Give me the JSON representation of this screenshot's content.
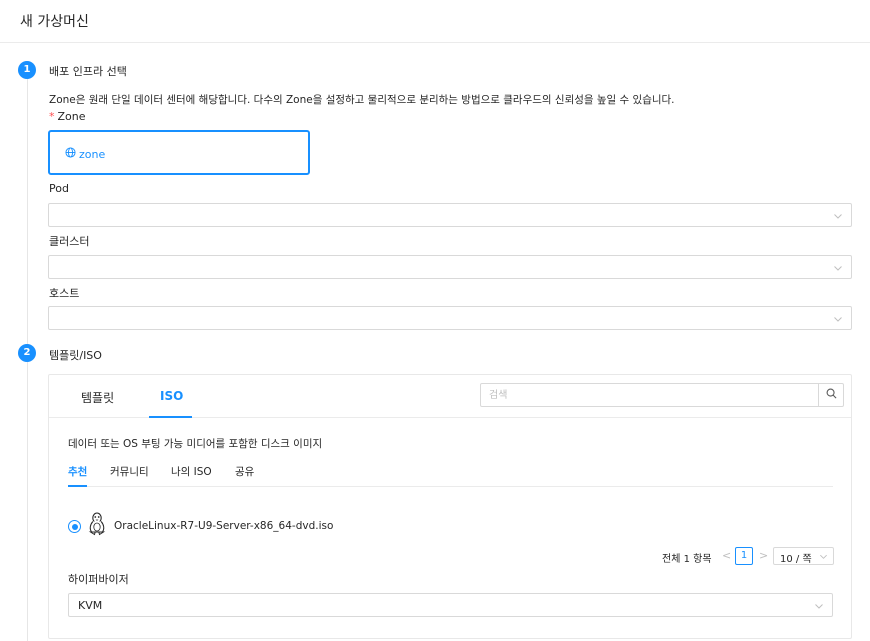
{
  "window": {
    "title": "새 가상머신"
  },
  "steps": [
    {
      "number": "1",
      "title": "배포 인프라 선택"
    },
    {
      "number": "2",
      "title": "템플릿/ISO"
    }
  ],
  "infra": {
    "description": "Zone은 원래 단일 데이터 센터에 해당합니다. 다수의 Zone을 설정하고 물리적으로 분리하는 방법으로 클라우드의 신뢰성을 높일 수 있습니다.",
    "zone_required_mark": "*",
    "zone_label": "Zone",
    "zone_card_value": "zone",
    "pod_label": "Pod",
    "pod_value": "",
    "cluster_label": "클러스터",
    "cluster_value": "",
    "host_label": "호스트",
    "host_value": ""
  },
  "template": {
    "tabs": [
      {
        "label": "템플릿",
        "active": false
      },
      {
        "label": "ISO",
        "active": true
      }
    ],
    "search_placeholder": "검색",
    "description": "데이터 또는 OS 부팅 가능 미디어를 포함한 디스크 이미지",
    "subtabs": [
      {
        "label": "추천",
        "active": true
      },
      {
        "label": "커뮤니티",
        "active": false
      },
      {
        "label": "나의 ISO",
        "active": false
      },
      {
        "label": "공유",
        "active": false
      }
    ],
    "iso_items": [
      {
        "name": "OracleLinux-R7-U9-Server-x86_64-dvd.iso",
        "selected": true,
        "icon": "linux-tux-icon"
      }
    ],
    "pagination": {
      "total_text": "전체 1 항목",
      "prev": "<",
      "current_page": "1",
      "next": ">",
      "page_size": "10 / 쪽"
    },
    "hypervisor_label": "하이퍼바이저",
    "hypervisor_value": "KVM"
  },
  "colors": {
    "accent": "#1890ff",
    "required": "#ff4d4f",
    "border": "#d9d9d9"
  }
}
